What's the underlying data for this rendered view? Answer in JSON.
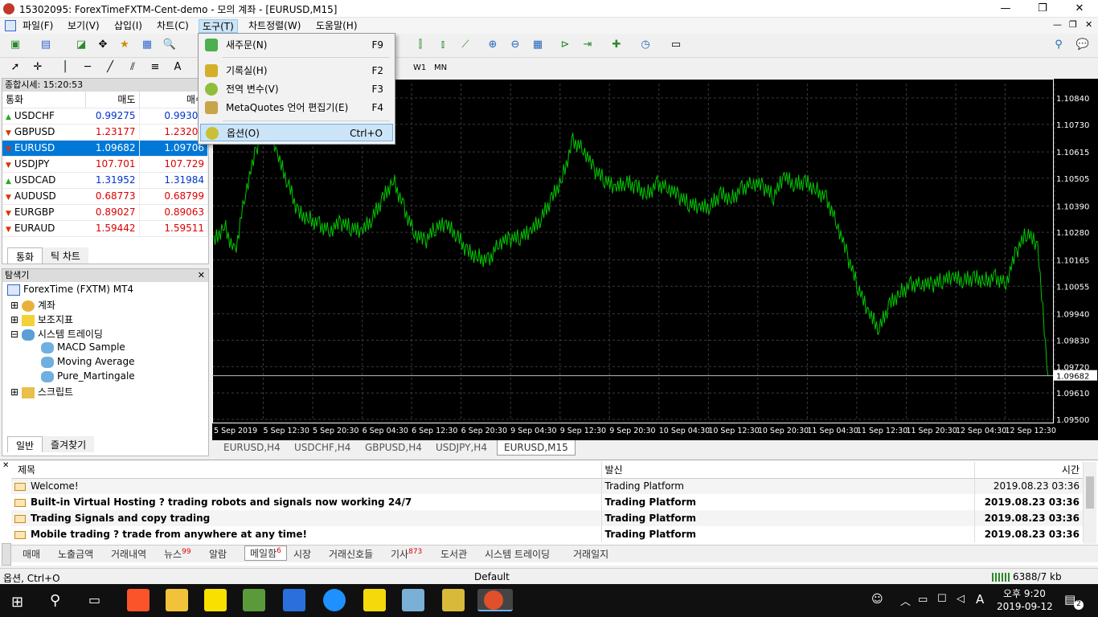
{
  "window": {
    "title": "15302095: ForexTimeFXTM-Cent-demo - 모의 계좌 - [EURUSD,M15]"
  },
  "menu": [
    "파일(F)",
    "보기(V)",
    "삽입(I)",
    "차트(C)",
    "도구(T)",
    "차트정렬(W)",
    "도움말(H)"
  ],
  "tools_menu": [
    {
      "label": "새주문(N)",
      "shortcut": "F9"
    },
    {
      "label": "기록실(H)",
      "shortcut": "F2"
    },
    {
      "label": "전역 변수(V)",
      "shortcut": "F3"
    },
    {
      "label": "MetaQuotes 언어 편집기(E)",
      "shortcut": "F4"
    },
    {
      "label": "옵션(O)",
      "shortcut": "Ctrl+O"
    }
  ],
  "timeframes": [
    "W1",
    "MN"
  ],
  "market_watch": {
    "header": "종합시세: 15:20:53",
    "col_symbol": "통화",
    "col_bid": "매도",
    "col_ask": "매수",
    "rows": [
      {
        "symbol": "USDCHF",
        "bid": "0.99275",
        "ask": "0.99305",
        "dir": "up",
        "color": "blue"
      },
      {
        "symbol": "GBPUSD",
        "bid": "1.23177",
        "ask": "1.23206",
        "dir": "down",
        "color": "red"
      },
      {
        "symbol": "EURUSD",
        "bid": "1.09682",
        "ask": "1.09706",
        "dir": "down",
        "color": "red"
      },
      {
        "symbol": "USDJPY",
        "bid": "107.701",
        "ask": "107.729",
        "dir": "down",
        "color": "red"
      },
      {
        "symbol": "USDCAD",
        "bid": "1.31952",
        "ask": "1.31984",
        "dir": "up",
        "color": "blue"
      },
      {
        "symbol": "AUDUSD",
        "bid": "0.68773",
        "ask": "0.68799",
        "dir": "down",
        "color": "red"
      },
      {
        "symbol": "EURGBP",
        "bid": "0.89027",
        "ask": "0.89063",
        "dir": "down",
        "color": "red"
      },
      {
        "symbol": "EURAUD",
        "bid": "1.59442",
        "ask": "1.59511",
        "dir": "down",
        "color": "red"
      }
    ],
    "tabs": [
      "통화",
      "틱 차트"
    ]
  },
  "navigator": {
    "header": "탐색기",
    "root": "ForexTime (FXTM) MT4",
    "items": [
      "계좌",
      "보조지표",
      "시스템 트레이딩",
      "MACD Sample",
      "Moving Average",
      "Pure_Martingale",
      "스크립트"
    ],
    "tabs": [
      "일반",
      "즐겨찾기"
    ]
  },
  "chart_data": {
    "type": "line",
    "symbol": "EURUSD,M15",
    "y_ticks": [
      "1.10840",
      "1.10730",
      "1.10615",
      "1.10505",
      "1.10390",
      "1.10280",
      "1.10165",
      "1.10055",
      "1.09940",
      "1.09830",
      "1.09720",
      "1.09610",
      "1.09500"
    ],
    "ylim": [
      1.095,
      1.109
    ],
    "current_price": "1.09682",
    "x_ticks": [
      "5 Sep 2019",
      "5 Sep 12:30",
      "5 Sep 20:30",
      "6 Sep 04:30",
      "6 Sep 12:30",
      "6 Sep 20:30",
      "9 Sep 04:30",
      "9 Sep 12:30",
      "9 Sep 20:30",
      "10 Sep 04:30",
      "10 Sep 12:30",
      "10 Sep 20:30",
      "11 Sep 04:30",
      "11 Sep 12:30",
      "11 Sep 20:30",
      "12 Sep 04:30",
      "12 Sep 12:30"
    ],
    "values": [
      1.1024,
      1.1031,
      1.1019,
      1.1045,
      1.1062,
      1.1078,
      1.106,
      1.1049,
      1.1036,
      1.1034,
      1.1031,
      1.1029,
      1.1032,
      1.103,
      1.1028,
      1.1034,
      1.1042,
      1.105,
      1.1038,
      1.1028,
      1.1024,
      1.103,
      1.1031,
      1.1027,
      1.102,
      1.1018,
      1.1016,
      1.1024,
      1.1025,
      1.1026,
      1.1028,
      1.1034,
      1.1042,
      1.1051,
      1.1066,
      1.1063,
      1.1054,
      1.105,
      1.1046,
      1.1049,
      1.1047,
      1.1044,
      1.1048,
      1.1047,
      1.1043,
      1.104,
      1.1038,
      1.1039,
      1.1044,
      1.1042,
      1.1046,
      1.1049,
      1.1047,
      1.1043,
      1.1051,
      1.1048,
      1.1049,
      1.1046,
      1.1042,
      1.1032,
      1.1018,
      1.1005,
      1.0994,
      1.0988,
      1.0998,
      1.1003,
      1.1006,
      1.1007,
      1.1006,
      1.1008,
      1.1009,
      1.1008,
      1.1009,
      1.1008,
      1.1009,
      1.1007,
      1.102,
      1.1028,
      1.1022,
      1.0968
    ],
    "grid": true,
    "color": "#00c800"
  },
  "chart_tabs": [
    "EURUSD,H4",
    "USDCHF,H4",
    "GBPUSD,H4",
    "USDJPY,H4",
    "EURUSD,M15"
  ],
  "terminal": {
    "col_subject": "제목",
    "col_from": "발신",
    "col_time": "시간",
    "rows": [
      {
        "subject": "Welcome!",
        "from": "Trading Platform",
        "time": "2019.08.23 03:36",
        "bold": false
      },
      {
        "subject": "Built-in Virtual Hosting ? trading robots and signals now working 24/7",
        "from": "Trading Platform",
        "time": "2019.08.23 03:36",
        "bold": true
      },
      {
        "subject": "Trading Signals and copy trading",
        "from": "Trading Platform",
        "time": "2019.08.23 03:36",
        "bold": true
      },
      {
        "subject": "Mobile trading ? trade from anywhere at any time!",
        "from": "Trading Platform",
        "time": "2019.08.23 03:36",
        "bold": true
      }
    ],
    "tabs": [
      {
        "label": "매매",
        "badge": ""
      },
      {
        "label": "노출금액",
        "badge": ""
      },
      {
        "label": "거래내역",
        "badge": ""
      },
      {
        "label": "뉴스",
        "badge": "99"
      },
      {
        "label": "알람",
        "badge": ""
      },
      {
        "label": "메일함",
        "badge": "6"
      },
      {
        "label": "시장",
        "badge": ""
      },
      {
        "label": "거래신호들",
        "badge": ""
      },
      {
        "label": "기사",
        "badge": "873"
      },
      {
        "label": "도서관",
        "badge": ""
      },
      {
        "label": "시스템 트레이딩",
        "badge": ""
      },
      {
        "label": "거래일지",
        "badge": ""
      }
    ]
  },
  "status": {
    "left": "옵션, Ctrl+O",
    "profile": "Default",
    "traffic": "6388/7 kb"
  },
  "taskbar": {
    "time": "오후 9:20",
    "date": "2019-09-12",
    "ime": "A",
    "notif": "2"
  }
}
